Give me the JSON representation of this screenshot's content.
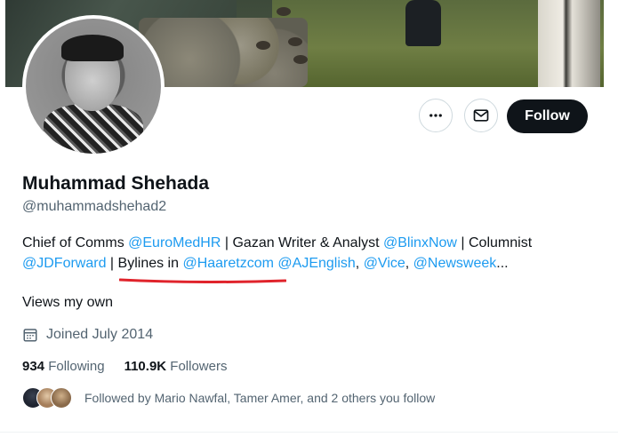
{
  "profile": {
    "name": "Muhammad Shehada",
    "handle": "@muhammadshehad2",
    "bio": {
      "line1": [
        {
          "text": "Chief of Comms ",
          "link": false
        },
        {
          "text": "@EuroMedHR",
          "link": true
        },
        {
          "text": " | Gazan Writer & Analyst ",
          "link": false
        },
        {
          "text": "@BlinxNow",
          "link": true
        },
        {
          "text": " | Columnist",
          "link": false
        }
      ],
      "line2": [
        {
          "text": "@JDForward",
          "link": true
        },
        {
          "text": " | Bylines in ",
          "link": false
        },
        {
          "text": "@Haaretzcom",
          "link": true
        },
        {
          "text": " ",
          "link": false
        },
        {
          "text": "@AJEnglish",
          "link": true
        },
        {
          "text": ", ",
          "link": false
        },
        {
          "text": "@Vice",
          "link": true
        },
        {
          "text": ", ",
          "link": false
        },
        {
          "text": "@Newsweek",
          "link": true
        },
        {
          "text": "...",
          "link": false
        }
      ]
    },
    "location": "Views my own",
    "joined": "Joined July 2014",
    "following_count": "934",
    "following_label": "Following",
    "followers_count": "110.9K",
    "followers_label": "Followers",
    "followed_by": "Followed by Mario Nawfal, Tamer Amer, and 2 others you follow"
  },
  "actions": {
    "more_icon": "more-horizontal-icon",
    "message_icon": "envelope-icon",
    "follow_label": "Follow"
  },
  "colors": {
    "link": "#1d9bf0",
    "secondary_text": "#536471",
    "follow_button_bg": "#0f1419",
    "annotation_underline": "#e0232b"
  }
}
